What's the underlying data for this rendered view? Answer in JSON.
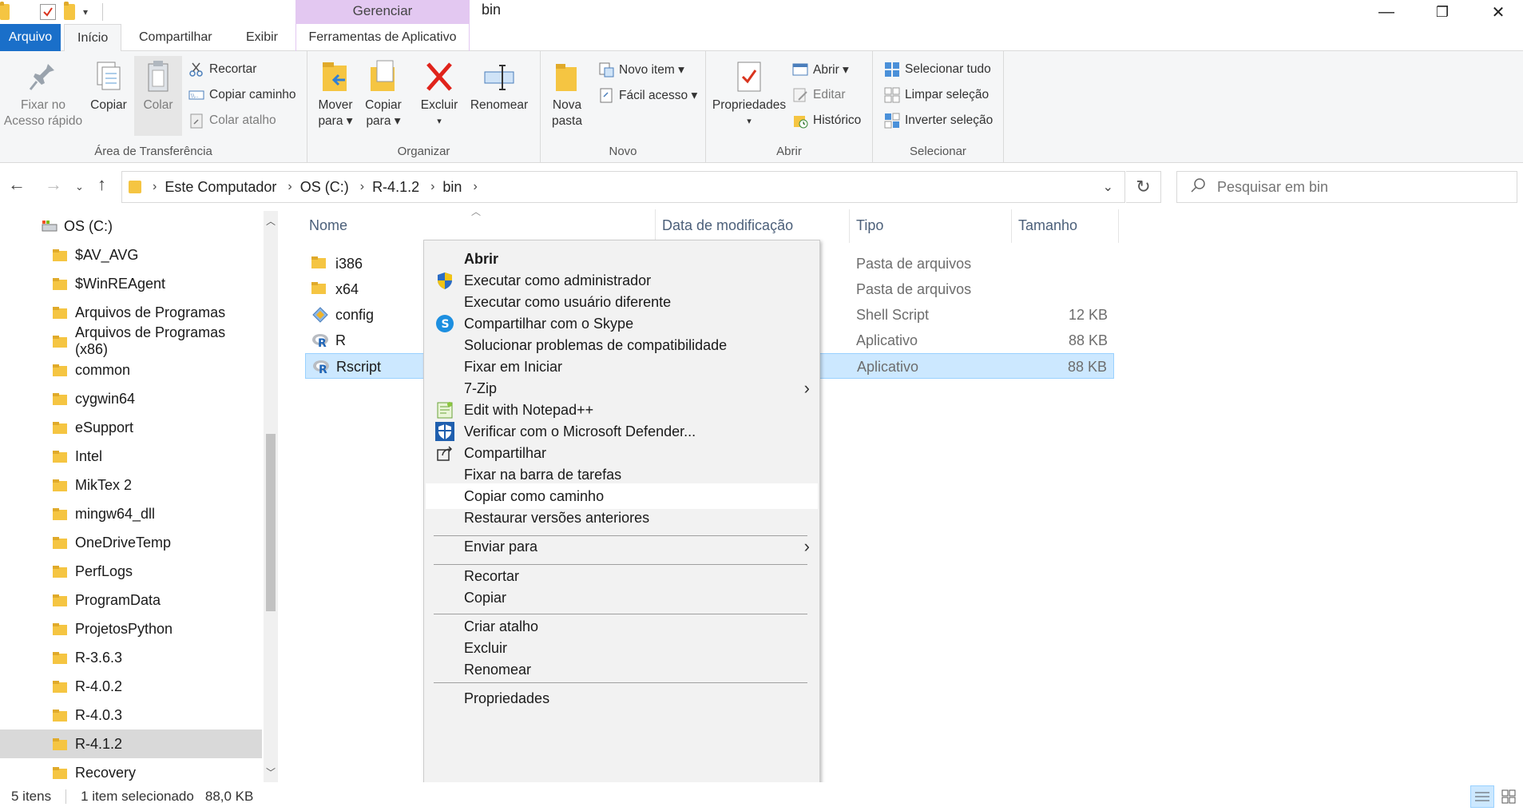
{
  "titlebar": {
    "context_tab": "Gerenciar",
    "title": "bin",
    "minimize": "—",
    "maximize": "❐",
    "close": "✕"
  },
  "tabs": {
    "file": "Arquivo",
    "home": "Início",
    "share": "Compartilhar",
    "view": "Exibir",
    "app_tools": "Ferramentas de Aplicativo"
  },
  "ribbon": {
    "clipboard": {
      "label": "Área de Transferência",
      "pin": "Fixar no\nAcesso rápido",
      "copy": "Copiar",
      "paste": "Colar",
      "cut": "Recortar",
      "copy_path": "Copiar caminho",
      "paste_shortcut": "Colar atalho"
    },
    "organize": {
      "label": "Organizar",
      "move_to": "Mover\npara ▾",
      "copy_to": "Copiar\npara ▾",
      "delete": "Excluir",
      "rename": "Renomear"
    },
    "new": {
      "label": "Novo",
      "new_folder": "Nova\npasta",
      "new_item": "Novo item ▾",
      "easy_access": "Fácil acesso ▾"
    },
    "open": {
      "label": "Abrir",
      "properties": "Propriedades",
      "open": "Abrir ▾",
      "edit": "Editar",
      "history": "Histórico"
    },
    "select": {
      "label": "Selecionar",
      "select_all": "Selecionar tudo",
      "select_none": "Limpar seleção",
      "invert": "Inverter seleção"
    }
  },
  "address": {
    "crumbs": [
      "Este Computador",
      "OS (C:)",
      "R-4.1.2",
      "bin"
    ],
    "search_placeholder": "Pesquisar em bin"
  },
  "navpane": {
    "items": [
      "OS (C:)",
      "$AV_AVG",
      "$WinREAgent",
      "Arquivos de Programas",
      "Arquivos de Programas (x86)",
      "common",
      "cygwin64",
      "eSupport",
      "Intel",
      "MikTex 2",
      "mingw64_dll",
      "OneDriveTemp",
      "PerfLogs",
      "ProgramData",
      "ProjetosPython",
      "R-3.6.3",
      "R-4.0.2",
      "R-4.0.3",
      "R-4.1.2",
      "Recovery"
    ]
  },
  "columns": {
    "name": "Nome",
    "date": "Data de modificação",
    "type": "Tipo",
    "size": "Tamanho"
  },
  "files": [
    {
      "name": "i386",
      "type": "Pasta de arquivos",
      "size": ""
    },
    {
      "name": "x64",
      "type": "Pasta de arquivos",
      "size": ""
    },
    {
      "name": "config",
      "type": "Shell Script",
      "size": "12 KB"
    },
    {
      "name": "R",
      "type": "Aplicativo",
      "size": "88 KB"
    },
    {
      "name": "Rscript",
      "type": "Aplicativo",
      "size": "88 KB"
    }
  ],
  "context_menu": {
    "items": [
      "Abrir",
      "Executar como administrador",
      "Executar como usuário diferente",
      "Compartilhar com o Skype",
      "Solucionar problemas de compatibilidade",
      "Fixar em Iniciar",
      "7-Zip",
      "Edit with Notepad++",
      "Verificar com o Microsoft Defender...",
      "Compartilhar",
      "Fixar na barra de tarefas",
      "Copiar como caminho",
      "Restaurar versões anteriores",
      "Enviar para",
      "Recortar",
      "Copiar",
      "Criar atalho",
      "Excluir",
      "Renomear",
      "Propriedades"
    ]
  },
  "status": {
    "count": "5 itens",
    "selection": "1 item selecionado",
    "size": "88,0 KB"
  },
  "colors": {
    "accent": "#1a6fc9",
    "context_tab": "#e3c8f1",
    "selection": "#cce8ff",
    "folder": "#f5c542"
  }
}
